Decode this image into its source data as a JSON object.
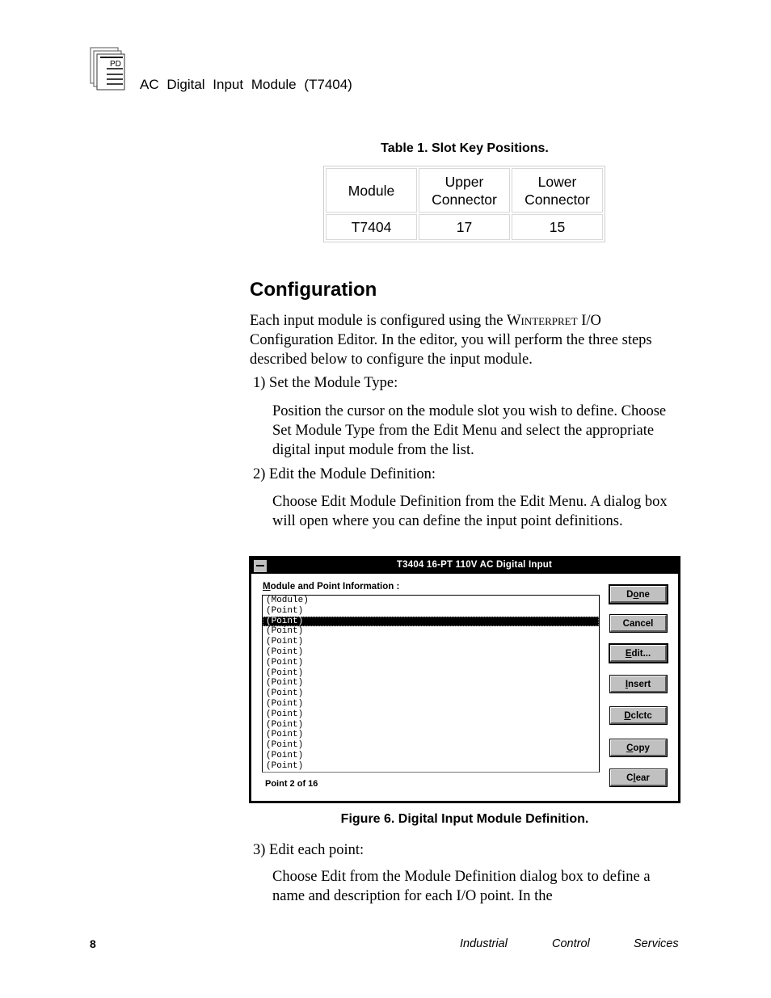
{
  "header": {
    "logo_icon": "pd-document-stack-icon",
    "logo_text": "PD",
    "title": "AC Digital Input Module (T7404)"
  },
  "table1": {
    "caption": "Table 1.  Slot Key Positions.",
    "columns": [
      "Module",
      "Upper Connector",
      "Lower Connector"
    ],
    "rows": [
      [
        "T7404",
        "17",
        "15"
      ]
    ]
  },
  "section": {
    "heading": "Configuration",
    "intro_before": "Each input module is configured using the ",
    "intro_brand": "Winterpret",
    "intro_after": " I/O Configuration Editor.  In the editor, you will perform the three steps described below to configure the input module.",
    "steps": [
      {
        "label": "1) Set the Module Type:",
        "body": "Position the cursor on the module slot you wish to define. Choose Set Module Type from the Edit Menu and select the appropriate digital input module from the list."
      },
      {
        "label": "2) Edit the Module Definition:",
        "body": "Choose Edit Module Definition from the Edit Menu.  A dialog box will open where you can define the input point definitions."
      },
      {
        "label": "3) Edit each point:",
        "body": "Choose Edit from the Module Definition dialog box to define a name and description for each I/O point.  In the"
      }
    ]
  },
  "dialog": {
    "title": "T3404 16-PT  110V AC Digital Input",
    "list_label_mnemonic": "M",
    "list_label_rest": "odule and Point Information :",
    "list_items": [
      "(Module)",
      "(Point)",
      "(Point)",
      "(Point)",
      "(Point)",
      "(Point)",
      "(Point)",
      "(Point)",
      "(Point)",
      "(Point)",
      "(Point)",
      "(Point)",
      "(Point)",
      "(Point)",
      "(Point)",
      "(Point)",
      "(Point)"
    ],
    "selected_index": 2,
    "status": "Point 2  of 16",
    "buttons": [
      {
        "pre": "D",
        "mn": "o",
        "post": "ne"
      },
      {
        "pre": "Cancel",
        "mn": "",
        "post": ""
      },
      {
        "pre": "",
        "mn": "E",
        "post": "dit..."
      },
      {
        "pre": "",
        "mn": "I",
        "post": "nsert"
      },
      {
        "pre": "",
        "mn": "D",
        "post": "clctc"
      },
      {
        "pre": "",
        "mn": "C",
        "post": "opy"
      },
      {
        "pre": "C",
        "mn": "l",
        "post": "ear"
      }
    ]
  },
  "figure": {
    "caption": "Figure 6.  Digital Input Module Definition."
  },
  "footer": {
    "page_number": "8",
    "company": [
      "Industrial",
      "Control",
      "Services"
    ]
  }
}
